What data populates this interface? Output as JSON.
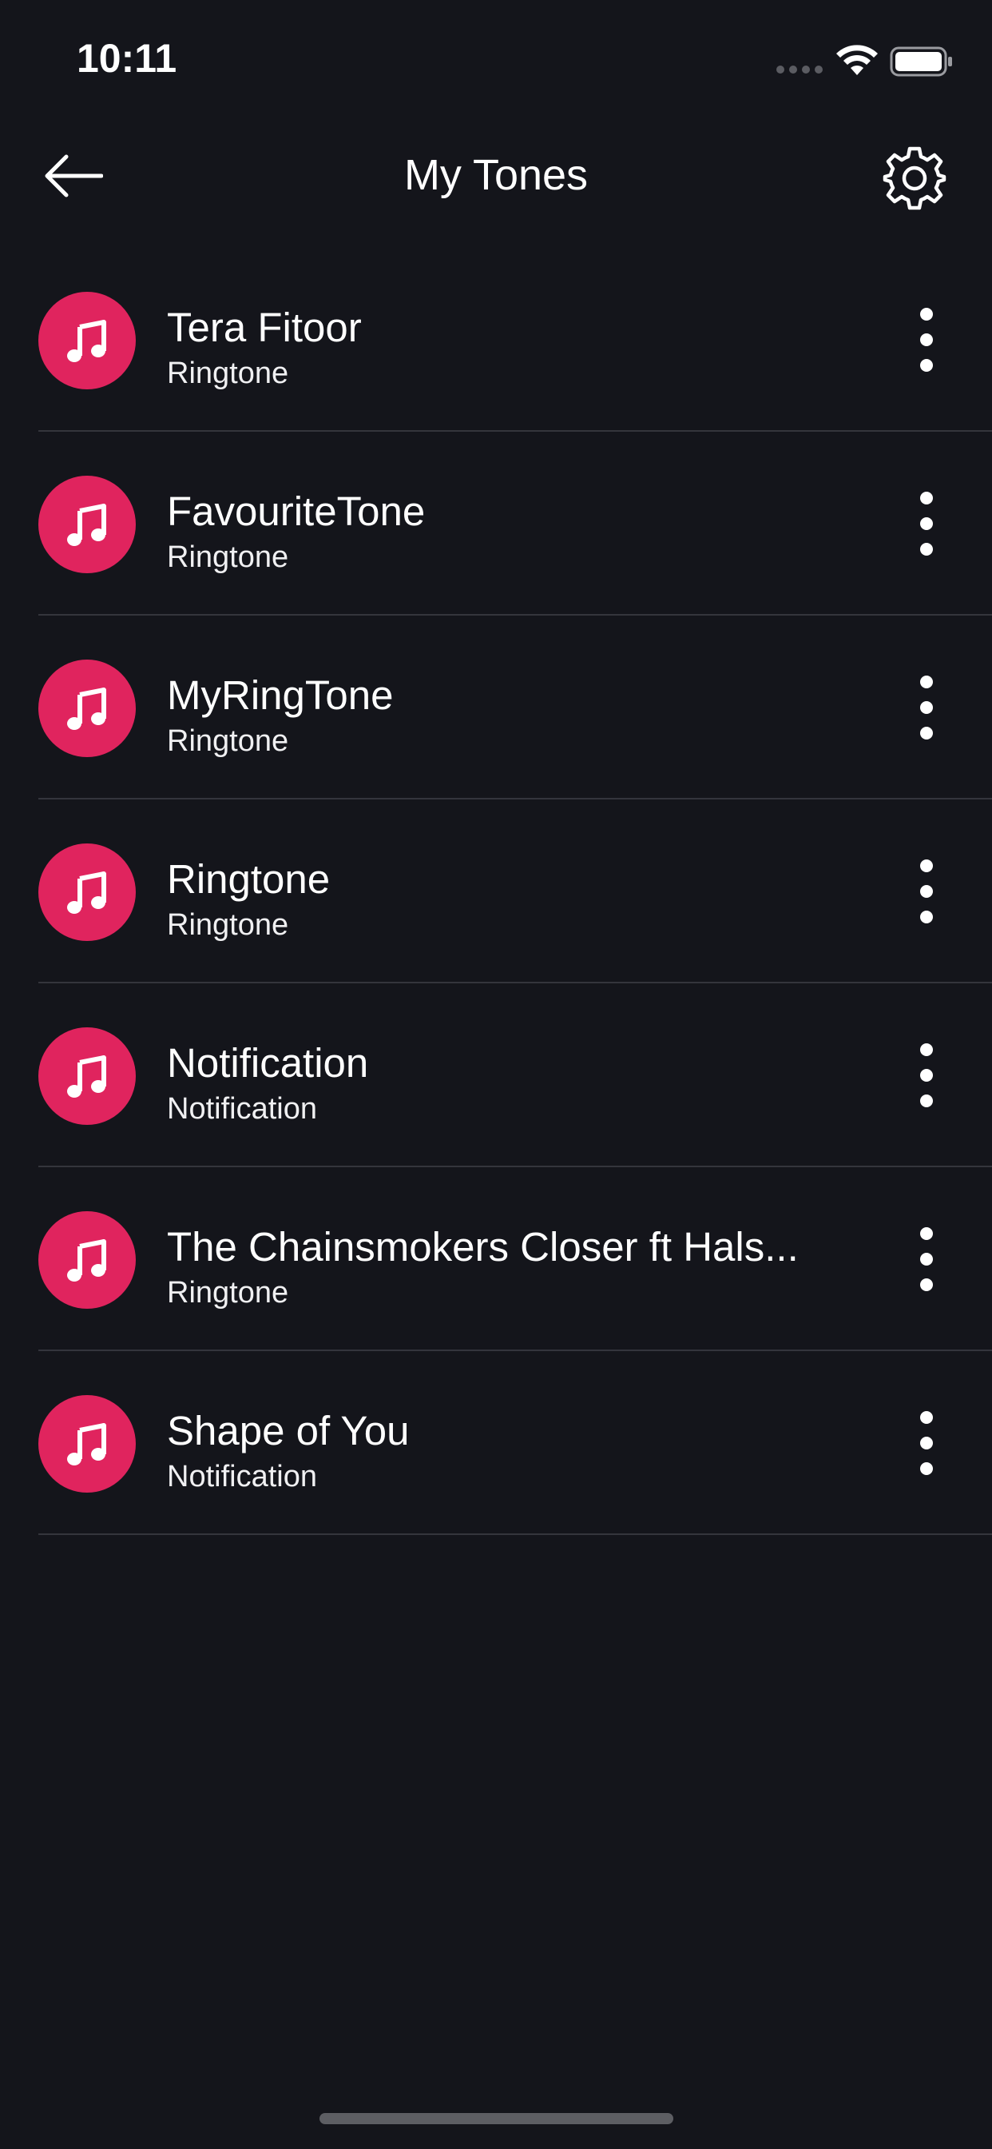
{
  "status_bar": {
    "time": "10:11"
  },
  "header": {
    "title": "My Tones",
    "back_icon": "arrow-left-icon",
    "settings_icon": "gear-icon"
  },
  "colors": {
    "background": "#14151b",
    "accent": "#e0245e",
    "divider": "#34353c"
  },
  "tones": [
    {
      "title": "Tera Fitoor",
      "type": "Ringtone"
    },
    {
      "title": "FavouriteTone",
      "type": "Ringtone"
    },
    {
      "title": "MyRingTone",
      "type": "Ringtone"
    },
    {
      "title": "Ringtone",
      "type": "Ringtone"
    },
    {
      "title": "Notification",
      "type": "Notification"
    },
    {
      "title": "The Chainsmokers Closer ft Hals...",
      "type": "Ringtone"
    },
    {
      "title": "Shape of You",
      "type": "Notification"
    }
  ]
}
